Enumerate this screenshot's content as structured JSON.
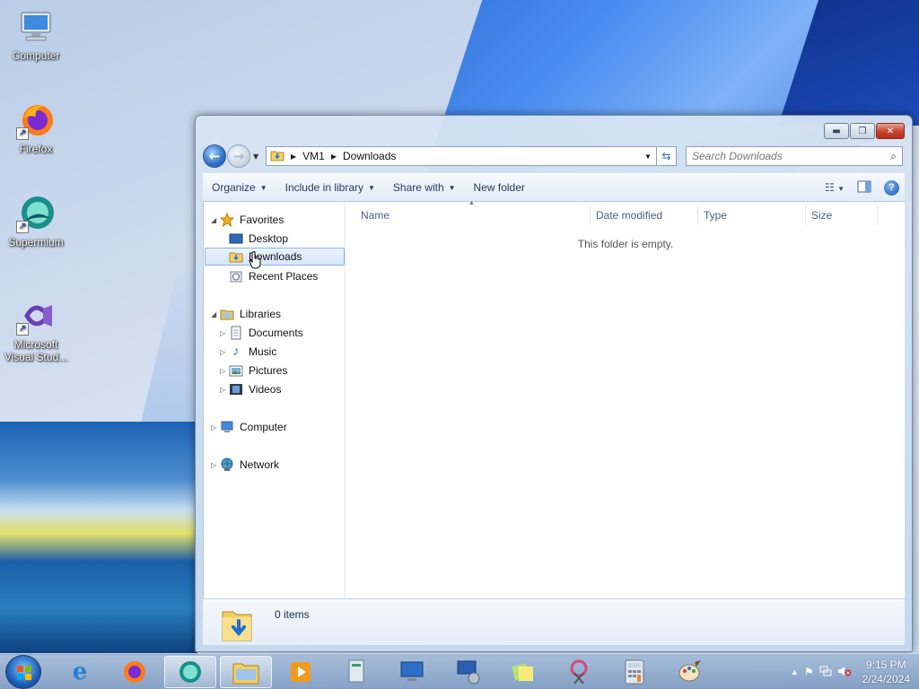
{
  "desktop": {
    "icons": [
      {
        "label": "Computer",
        "icon": "computer-icon"
      },
      {
        "label": "Firefox",
        "icon": "firefox-icon"
      },
      {
        "label": "Supermium",
        "icon": "supermium-icon"
      },
      {
        "label": "Microsoft Visual Stud...",
        "icon": "visual-studio-icon"
      }
    ]
  },
  "window": {
    "breadcrumb": [
      "VM1",
      "Downloads"
    ],
    "search_placeholder": "Search Downloads",
    "toolbar": {
      "organize": "Organize",
      "include_in_library": "Include in library",
      "share_with": "Share with",
      "new_folder": "New folder"
    },
    "nav": {
      "favorites": "Favorites",
      "desktop": "Desktop",
      "downloads": "Downloads",
      "recent_places": "Recent Places",
      "libraries": "Libraries",
      "documents": "Documents",
      "music": "Music",
      "pictures": "Pictures",
      "videos": "Videos",
      "computer": "Computer",
      "network": "Network"
    },
    "columns": {
      "name": "Name",
      "date_modified": "Date modified",
      "type": "Type",
      "size": "Size"
    },
    "empty_message": "This folder is empty.",
    "details": {
      "items": "0 items"
    }
  },
  "taskbar": {
    "apps": [
      "internet-explorer-icon",
      "firefox-icon",
      "supermium-icon",
      "windows-explorer-icon",
      "media-player-icon",
      "document-icon",
      "remote-desktop-icon",
      "network-icon",
      "sticky-notes-icon",
      "snipping-tool-icon",
      "calculator-icon",
      "paint-icon"
    ],
    "clock": {
      "time": "9:15 PM",
      "date": "2/24/2024"
    }
  },
  "colors": {
    "accent": "#1f5fb8",
    "selection_border": "#88b4e6",
    "selection_fill": "#d6e7fb"
  }
}
